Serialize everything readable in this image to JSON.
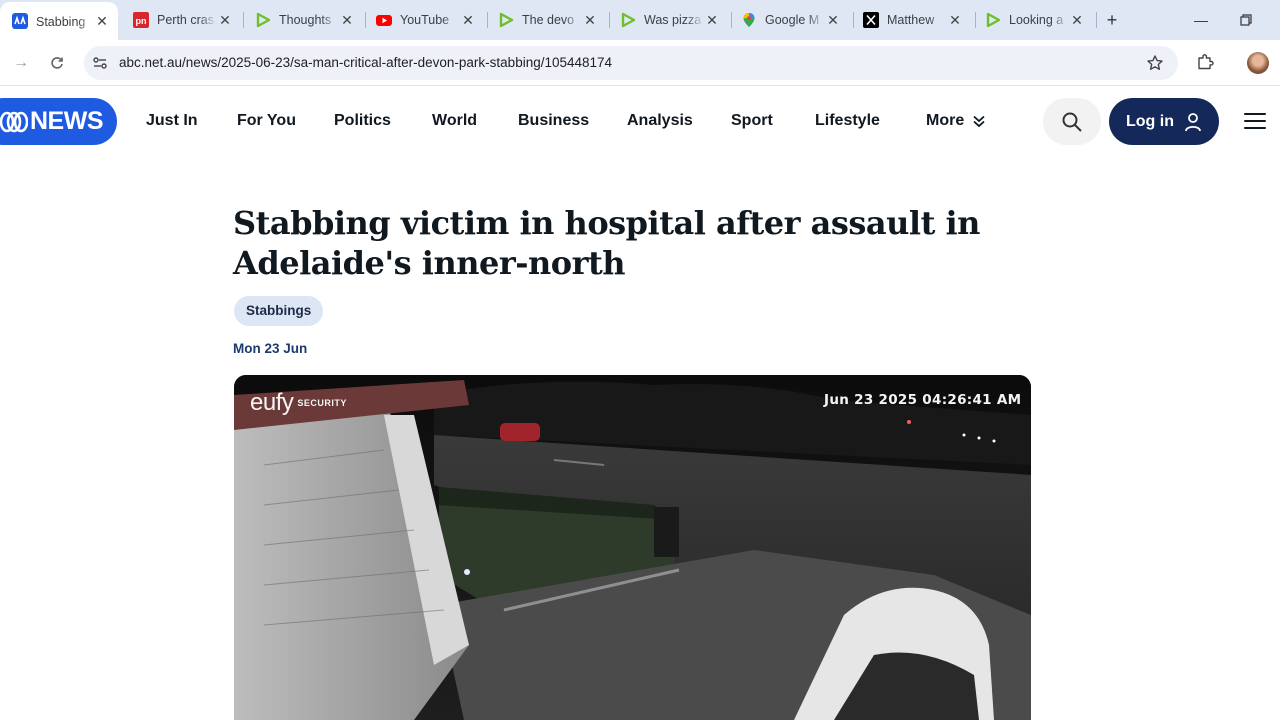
{
  "browser": {
    "tabs": [
      {
        "title": "Stabbing",
        "icon": "abc-news-icon",
        "active": true
      },
      {
        "title": "Perth cras",
        "icon": "pn-icon"
      },
      {
        "title": "Thoughts",
        "icon": "rumble-icon"
      },
      {
        "title": "YouTube",
        "icon": "youtube-icon"
      },
      {
        "title": "The devo",
        "icon": "rumble-icon"
      },
      {
        "title": "Was pizza",
        "icon": "rumble-icon"
      },
      {
        "title": "Google M",
        "icon": "google-maps-icon"
      },
      {
        "title": "Matthew",
        "icon": "x-icon"
      },
      {
        "title": "Looking a",
        "icon": "rumble-icon"
      }
    ],
    "url": "abc.net.au/news/2025-06-23/sa-man-critical-after-devon-park-stabbing/105448174"
  },
  "site": {
    "logo_text": "NEWS",
    "nav": [
      "Just In",
      "For You",
      "Politics",
      "World",
      "Business",
      "Analysis",
      "Sport",
      "Lifestyle",
      "More"
    ],
    "login_label": "Log in"
  },
  "article": {
    "headline": "Stabbing victim in hospital after assault in Adelaide's inner-north",
    "tag": "Stabbings",
    "date": "Mon 23 Jun",
    "video": {
      "brand": "eufy",
      "brand_sub": "SECURITY",
      "timestamp": "Jun 23 2025 04:26:41 AM"
    }
  },
  "colors": {
    "abc_blue": "#1f5be0",
    "login_navy": "#14285a",
    "tag_bg": "#dde6f5"
  }
}
